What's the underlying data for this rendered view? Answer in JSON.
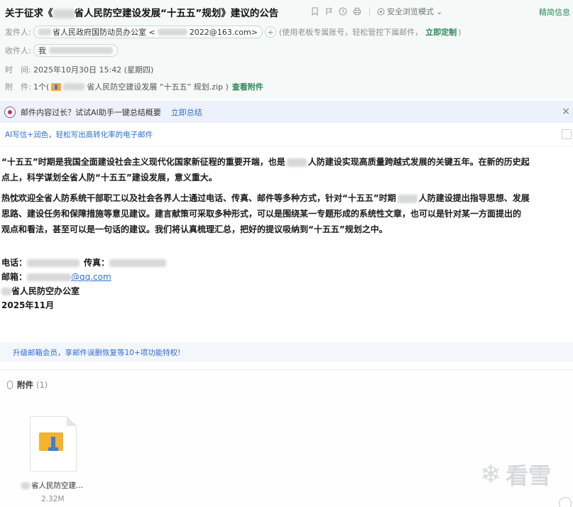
{
  "header": {
    "subject_prefix": "关于征求《",
    "subject_suffix": "省人民防空建设发展“十五五”规划》建议的公告",
    "safe_mode": "安全浏览模式",
    "simp_trad": "精简信息",
    "from_label": "发件人:",
    "from_name": "省人民政府国防动员办公室",
    "from_email_suffix": "2022@163.com>",
    "from_note": "(使用老板专属账号，轻松管控下属邮件，",
    "customize_link": "立即定制",
    "from_note_end": ")",
    "to_label": "收件人:",
    "to_name": "我",
    "time_label": "时　间:",
    "time_value": "2025年10月30日 15:42 (星期四)",
    "attach_label": "附　件:",
    "attach_count": "1个(",
    "attach_file": "省人民防空建设发展 “十五五” 规划.zip )",
    "view_attach_link": "查看附件"
  },
  "ai_bar": {
    "text": "邮件内容过长？试试AI助手一键总结概要",
    "link": "立即总结",
    "close": "×"
  },
  "ai_write": {
    "text": "AI写信+润色，轻松写出高转化率的电子邮件"
  },
  "body": {
    "p1_l1_a": "“十五五”时期是我国全面建设社会主义现代化国家新征程的重要开端，也是",
    "p1_l1_b": "人防建设实现高质量跨越式发展的关键五年。在新的历史起",
    "p1_l2": "点上，科学谋划全省人防“十五五”建设发展，意义重大。",
    "p2_l1_a": "热忱欢迎全省人防系统干部职工以及社会各界人士通过电话、传真、邮件等多种方式，针对“十五五”时期",
    "p2_l1_b": "人防建设提出指导思想、发展",
    "p2_l2": "思路、建设任务和保障措施等意见建议。建言献策可采取多种形式，可以是围绕某一专题形成的系统性文章，也可以是针对某一方面提出的",
    "p2_l3": "观点和看法，甚至可以是一句话的建议。我们将认真梳理汇总，把好的提议吸纳到“十五五”规划之中。"
  },
  "contact": {
    "phone_label": "电话：",
    "fax_label": "传真：",
    "email_label": "邮箱：",
    "email_suffix": "@qq.com",
    "org": "省人民防空办公室",
    "date": "2025年11月"
  },
  "upgrade": {
    "text": "升级邮箱会员，享邮件误删恢复等10+项功能特权!"
  },
  "attachments": {
    "title": "附件",
    "count": "(1)",
    "file_name": "省人民防空建...",
    "file_size": "2.32M"
  },
  "watermark": {
    "text": "看雪"
  }
}
